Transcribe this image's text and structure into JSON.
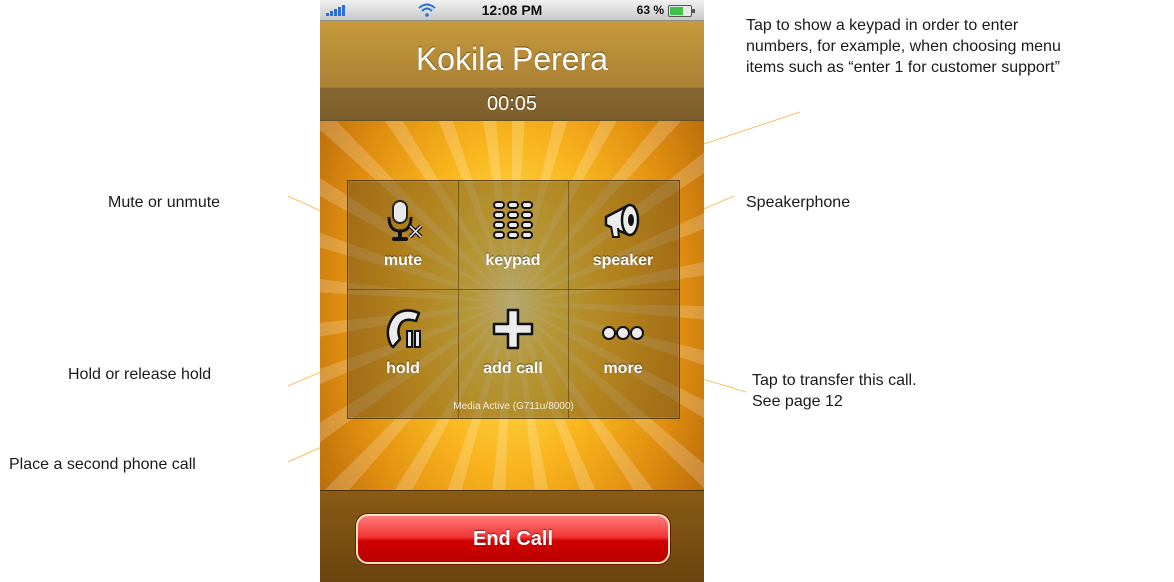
{
  "status_bar": {
    "time": "12:08 PM",
    "battery": "63 %",
    "battery_level": 0.63,
    "icons": [
      "signal-icon",
      "wifi-icon",
      "battery-icon"
    ]
  },
  "call": {
    "caller_name": "Kokila Perera",
    "duration": "00:05",
    "media_status": "Media Active (G711u/8000)"
  },
  "buttons": [
    {
      "label": "mute",
      "icon": "mute-icon"
    },
    {
      "label": "keypad",
      "icon": "keypad-icon"
    },
    {
      "label": "speaker",
      "icon": "speaker-icon"
    },
    {
      "label": "hold",
      "icon": "hold-icon"
    },
    {
      "label": "add call",
      "icon": "add-call-icon"
    },
    {
      "label": "more",
      "icon": "more-icon"
    }
  ],
  "end_call_label": "End Call",
  "annotations": {
    "keypad": [
      "Tap to show a keypad in order to enter",
      "numbers, for example, when choosing menu",
      "items such as “enter 1 for customer support”"
    ],
    "mute": "Mute or unmute",
    "speaker": "Speakerphone",
    "hold": "Hold or release hold",
    "more": [
      "Tap to transfer this call.",
      "See page 12"
    ],
    "add_call": "Place a second phone call"
  },
  "colors": {
    "end_call": "#e01010",
    "leader_line": "#f5c46a",
    "signal": "#2b6fd6",
    "battery": "#3ec24a"
  }
}
